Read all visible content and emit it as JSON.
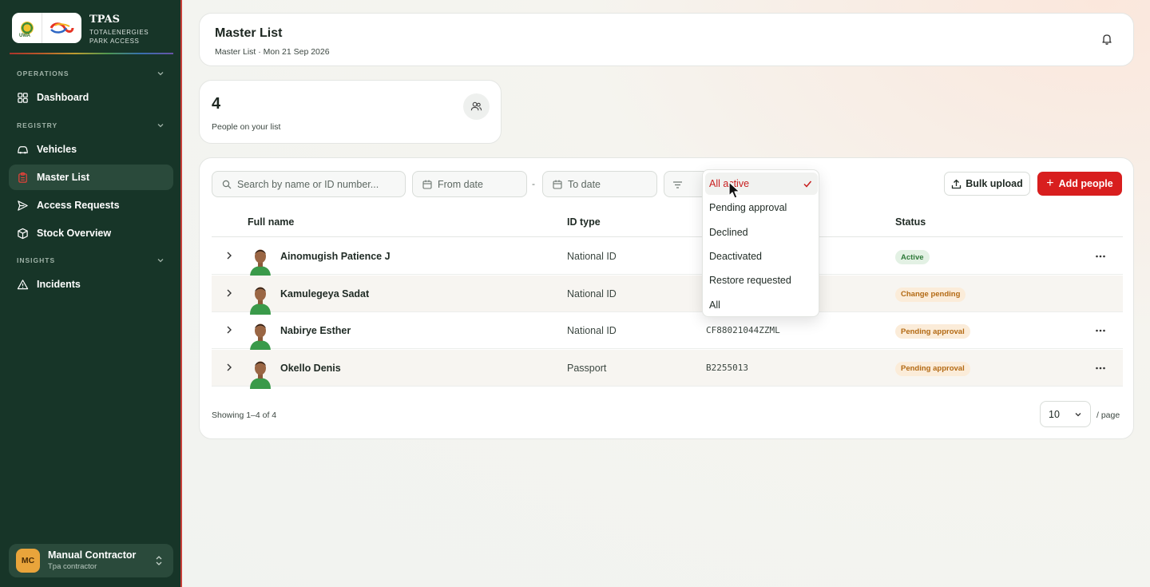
{
  "brand": {
    "title": "TPAS",
    "subtitle_line1": "TOTALENERGIES",
    "subtitle_line2": "PARK ACCESS",
    "seal_text": "UWA",
    "seal_icon": "uwa-seal-icon",
    "logo_icon": "totalenergies-logo-icon"
  },
  "sidebar": {
    "sections": {
      "operations": "OPERATIONS",
      "registry": "REGISTRY",
      "insights": "INSIGHTS"
    },
    "items": [
      {
        "label": "Dashboard",
        "icon": "grid-icon"
      },
      {
        "label": "Vehicles",
        "icon": "car-icon"
      },
      {
        "label": "Master List",
        "icon": "clipboard-icon",
        "active": true
      },
      {
        "label": "Access Requests",
        "icon": "send-icon"
      },
      {
        "label": "Stock Overview",
        "icon": "box-icon"
      },
      {
        "label": "Incidents",
        "icon": "warning-icon"
      }
    ],
    "user": {
      "initials": "MC",
      "name": "Manual Contractor",
      "role": "Tpa contractor"
    }
  },
  "header": {
    "title": "Master List",
    "subtitle": "Master List · Mon 21 Sep 2026"
  },
  "stat": {
    "value": "4",
    "label": "People on your list"
  },
  "toolbar": {
    "search_placeholder": "Search by name or ID number...",
    "from_date": "From date",
    "separator": "-",
    "to_date": "To date",
    "bulk_upload": "Bulk upload",
    "add_people": "Add people"
  },
  "table": {
    "headers": {
      "name": "Full name",
      "id_type": "ID type",
      "status": "Status"
    },
    "rows": [
      {
        "name": "Ainomugish Patience J",
        "id_type": "National ID",
        "id_number": "",
        "status": "Active",
        "status_kind": "active",
        "has_menu": true
      },
      {
        "name": "Kamulegeya Sadat",
        "id_type": "National ID",
        "id_number": "",
        "status": "Change pending",
        "status_kind": "change",
        "has_menu": false
      },
      {
        "name": "Nabirye Esther",
        "id_type": "National ID",
        "id_number": "CF88021044ZZML",
        "status": "Pending approval",
        "status_kind": "pending",
        "has_menu": true
      },
      {
        "name": "Okello Denis",
        "id_type": "Passport",
        "id_number": "B2255013",
        "status": "Pending approval",
        "status_kind": "pending",
        "has_menu": true
      }
    ]
  },
  "pagination": {
    "showing": "Showing 1–4 of 4",
    "page_size": "10",
    "per_page_label": "/ page"
  },
  "status_filter": {
    "selected": "All active",
    "options": [
      "All active",
      "Pending approval",
      "Declined",
      "Deactivated",
      "Restore requested",
      "All"
    ]
  },
  "colors": {
    "sidebar_bg": "#173528",
    "accent_red": "#d81e1e",
    "active_badge": "#2f7a3a",
    "pending_badge": "#b36a14"
  }
}
